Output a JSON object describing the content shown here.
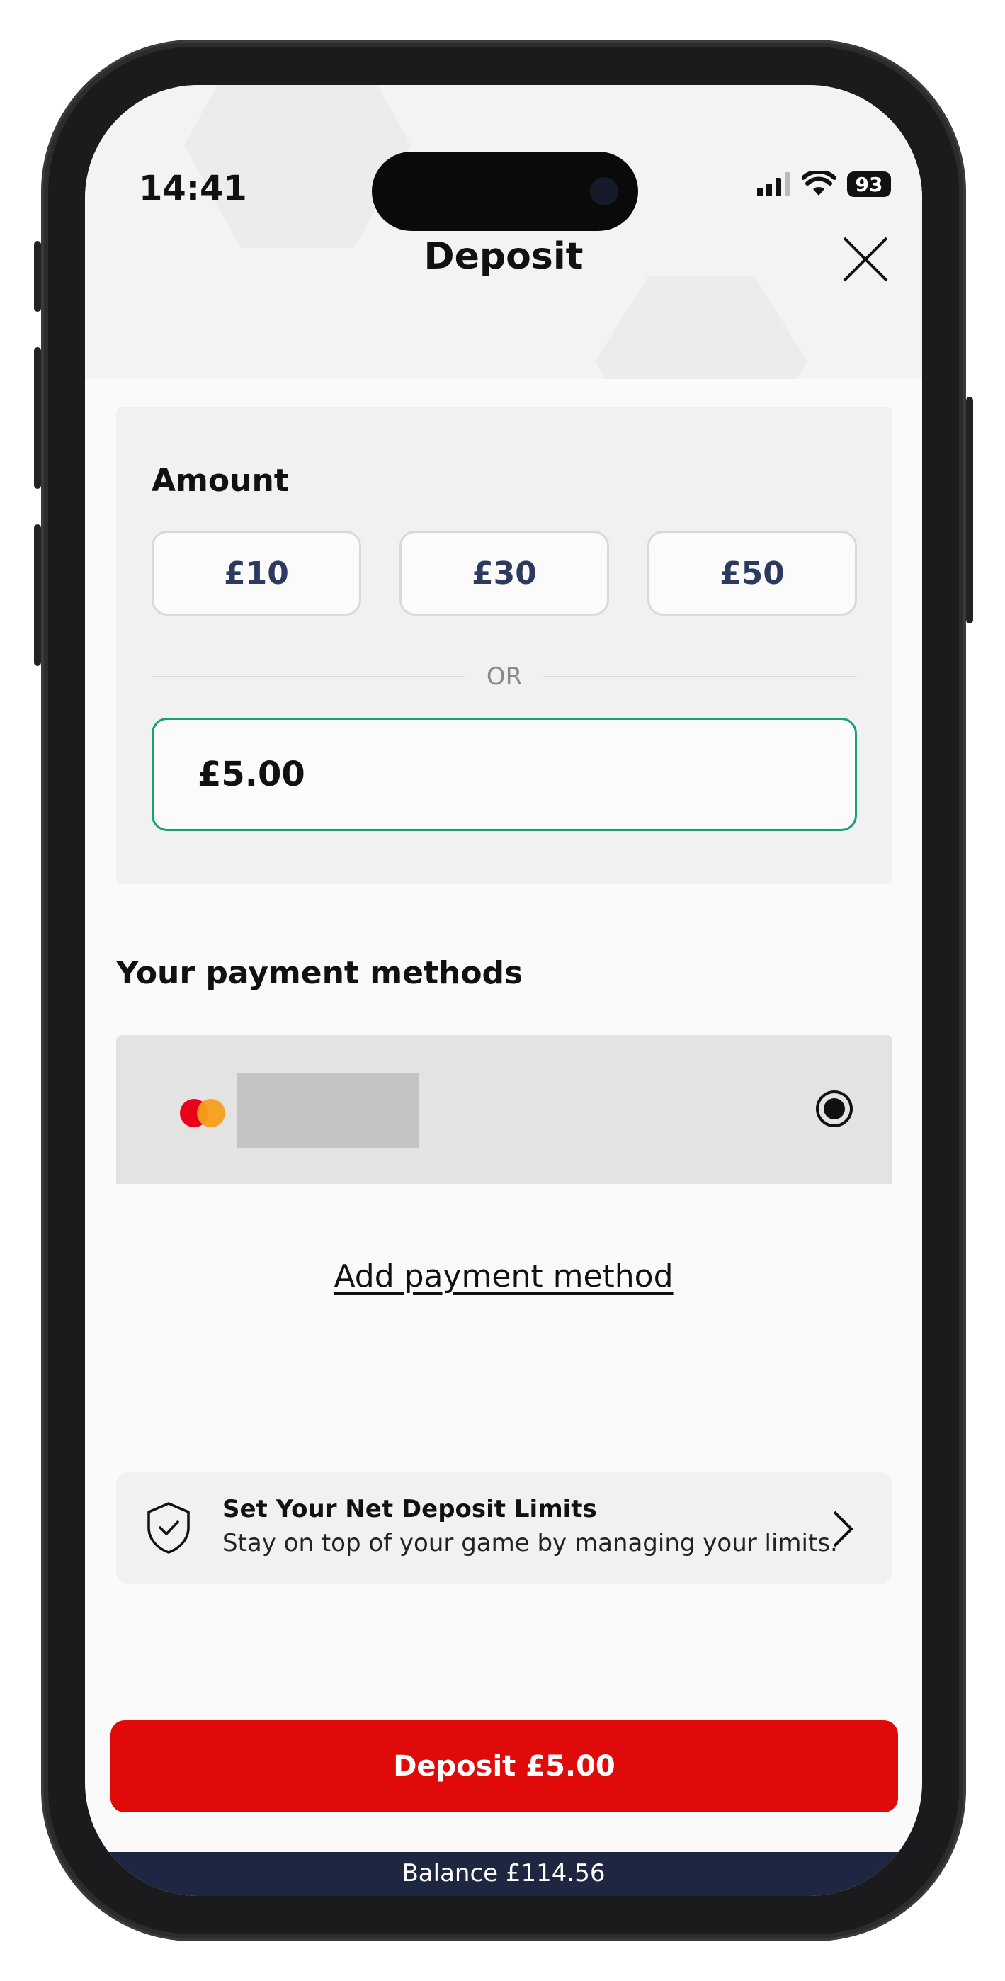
{
  "status": {
    "time": "14:41",
    "battery": "93"
  },
  "header": {
    "title": "Deposit"
  },
  "amount": {
    "label": "Amount",
    "presets": [
      "£10",
      "£30",
      "£50"
    ],
    "or": "OR",
    "value": "£5.00"
  },
  "payment_methods": {
    "title": "Your payment methods",
    "add_label": "Add payment method"
  },
  "limits": {
    "title": "Set Your Net Deposit Limits",
    "subtitle": "Stay on top of your game by managing your limits."
  },
  "deposit_button": "Deposit £5.00",
  "balance": "Balance £114.56",
  "colors": {
    "accent_green": "#18a07a",
    "deposit_red": "#e10a0a",
    "navy": "#1f2641",
    "chip_text": "#2b3a5e"
  }
}
